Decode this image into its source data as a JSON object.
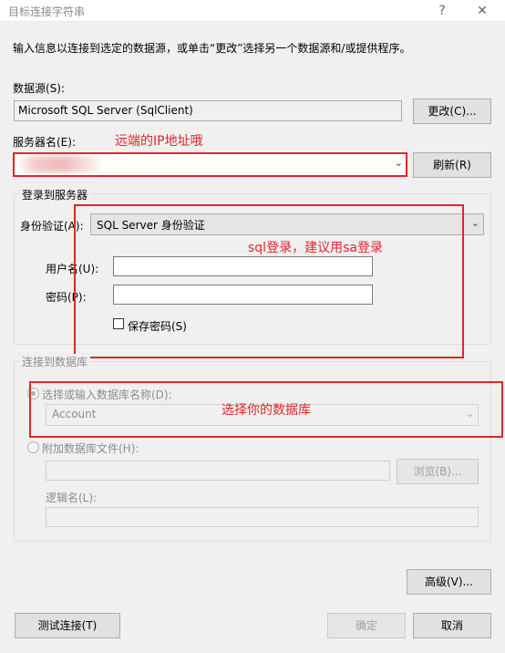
{
  "window": {
    "title": "目标连接字符串",
    "help_glyph": "?",
    "close_glyph": "✕"
  },
  "intro": "输入信息以连接到选定的数据源，或单击“更改”选择另一个数据源和/或提供程序。",
  "datasource": {
    "label": "数据源(S):",
    "value": "Microsoft SQL Server (SqlClient)",
    "change_button": "更改(C)..."
  },
  "server": {
    "label": "服务器名(E):",
    "annotation": "远端的IP地址哦",
    "value": "",
    "refresh_button": "刷新(R)"
  },
  "login": {
    "group_title": "登录到服务器",
    "auth_label": "身份验证(A):",
    "auth_value": "SQL Server 身份验证",
    "annotation": "sql登录，建议用sa登录",
    "username_label": "用户名(U):",
    "username_value": "",
    "password_label": "密码(P):",
    "password_value": "",
    "save_password_label": "保存密码(S)",
    "save_password_checked": false
  },
  "database": {
    "group_title": "连接到数据库",
    "select_label": "选择或输入数据库名称(D):",
    "select_value": "Account",
    "annotation": "选择你的数据库",
    "attach_label": "附加数据库文件(H):",
    "attach_value": "",
    "browse_button": "浏览(B)...",
    "logical_label": "逻辑名(L):",
    "logical_value": ""
  },
  "advanced_button": "高级(V)...",
  "footer": {
    "test_button": "测试连接(T)",
    "ok_button": "确定",
    "cancel_button": "取消"
  },
  "colors": {
    "annotation_red": "#e0262b",
    "dialog_bg": "#f0f0f0",
    "disabled_text": "#8c8c8c"
  }
}
